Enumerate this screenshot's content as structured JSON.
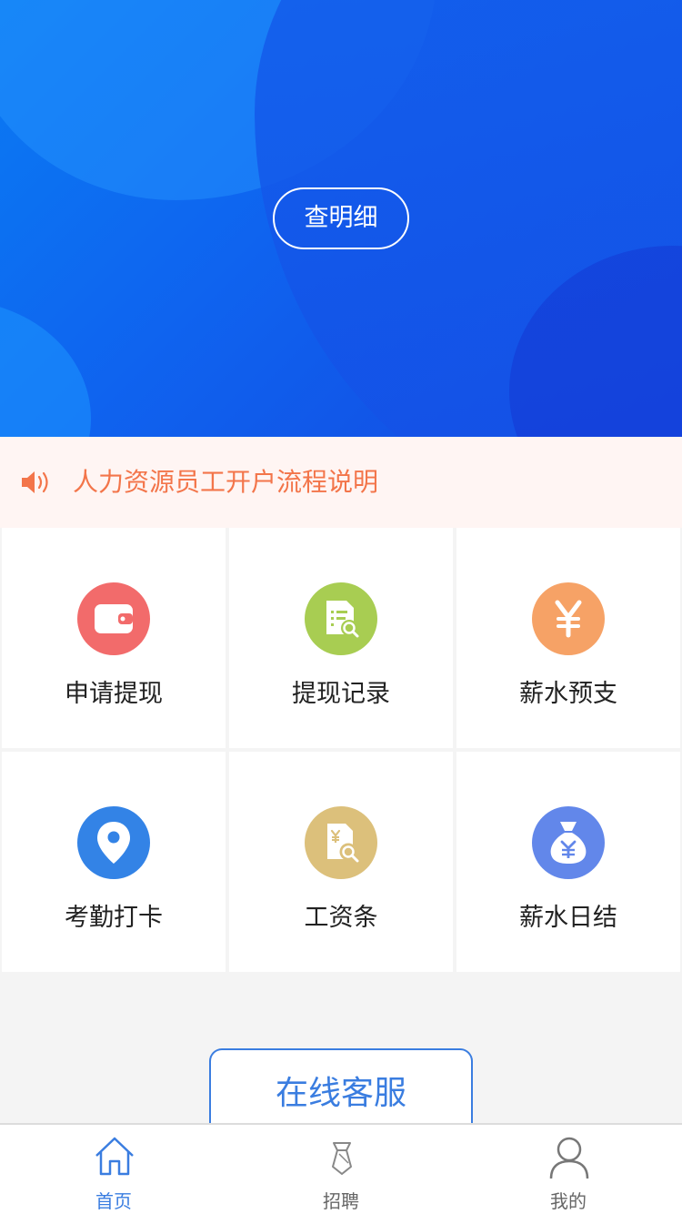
{
  "banner": {
    "detail_button": "查明细"
  },
  "notice": {
    "icon": "speaker-icon",
    "text": "人力资源员工开户流程说明",
    "color": "#f3754a"
  },
  "grid": {
    "items": [
      {
        "label": "申请提现",
        "icon": "wallet-icon",
        "color": "#f26b6b"
      },
      {
        "label": "提现记录",
        "icon": "document-search-icon",
        "color": "#a8cd52"
      },
      {
        "label": "薪水预支",
        "icon": "yen-icon",
        "color": "#f6a266"
      },
      {
        "label": "考勤打卡",
        "icon": "location-pin-icon",
        "color": "#3383e6"
      },
      {
        "label": "工资条",
        "icon": "salary-slip-icon",
        "color": "#dcc07b"
      },
      {
        "label": "薪水日结",
        "icon": "money-bag-icon",
        "color": "#6287ea"
      }
    ]
  },
  "service_button": "在线客服",
  "tabbar": {
    "tabs": [
      {
        "label": "首页",
        "icon": "home-icon",
        "active": true
      },
      {
        "label": "招聘",
        "icon": "tie-icon",
        "active": false
      },
      {
        "label": "我的",
        "icon": "user-icon",
        "active": false
      }
    ],
    "active_color": "#3a7de0"
  }
}
